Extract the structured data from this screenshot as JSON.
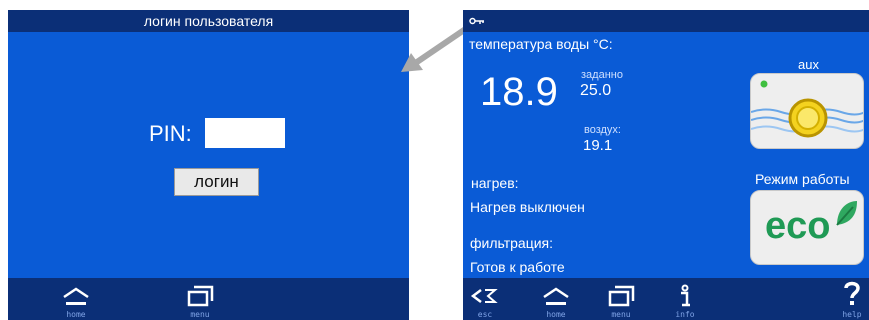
{
  "login_screen": {
    "title": "логин пользователя",
    "pin_label": "PIN:",
    "pin_value": "",
    "login_button": "логин",
    "nav": {
      "home": "home",
      "menu": "menu"
    }
  },
  "status_screen": {
    "water_temp_label": "температура воды °C:",
    "water_temp_value": "18.9",
    "setpoint_label": "заданно",
    "setpoint_value": "25.0",
    "air_label": "воздух:",
    "air_value": "19.1",
    "heating_label": "нагрев:",
    "heating_status": "Нагрев выключен",
    "filtration_label": "фильтрация:",
    "filtration_status": "Готов к работе",
    "aux_label": "aux",
    "mode_label": "Режим работы",
    "mode_value": "eco",
    "nav": {
      "esc": "esc",
      "home": "home",
      "menu": "menu",
      "info": "info",
      "help": "help"
    }
  },
  "colors": {
    "panel": "#0a5bd6",
    "bar": "#0b2f77",
    "eco": "#1f9a55"
  }
}
